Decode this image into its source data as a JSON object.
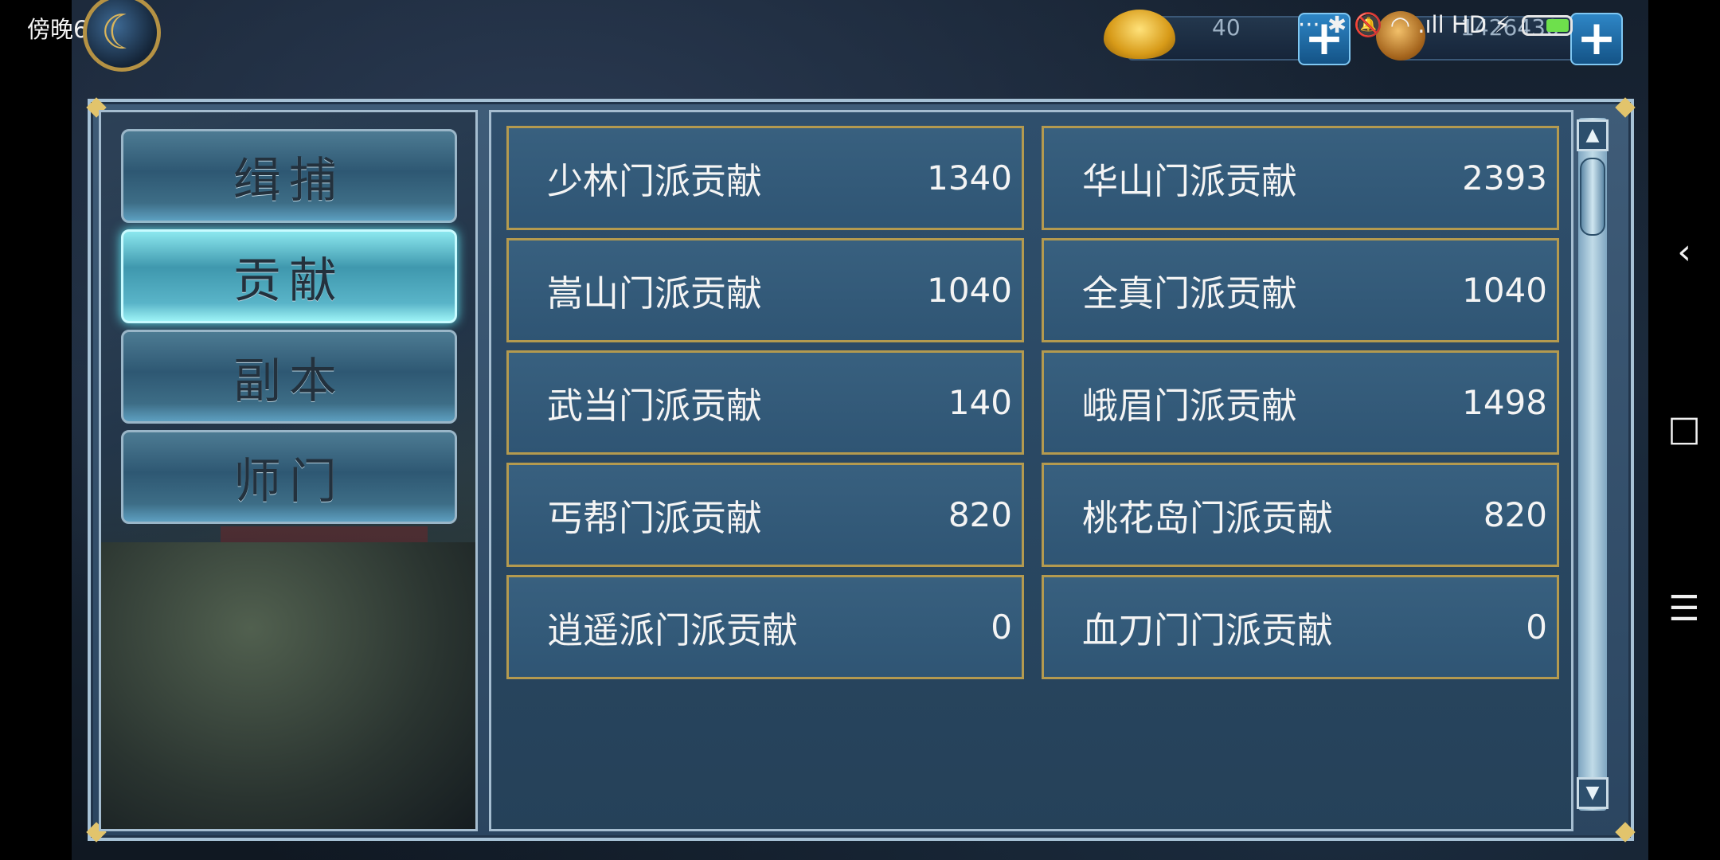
{
  "status_bar": {
    "time": "傍晚6:43",
    "icons_text": "··· ✱ 🔕 ◠ .ıll HD ⚡",
    "battery": "battery-icon"
  },
  "hud": {
    "gold_ingot_value": "40",
    "coin_value": "1426430",
    "plus_label": "+"
  },
  "tabs": [
    {
      "label": "缉捕",
      "active": false
    },
    {
      "label": "贡献",
      "active": true
    },
    {
      "label": "副本",
      "active": false
    },
    {
      "label": "师门",
      "active": false
    }
  ],
  "contributions": [
    {
      "name": "少林门派贡献",
      "value": "1340"
    },
    {
      "name": "华山门派贡献",
      "value": "2393"
    },
    {
      "name": "嵩山门派贡献",
      "value": "1040"
    },
    {
      "name": "全真门派贡献",
      "value": "1040"
    },
    {
      "name": "武当门派贡献",
      "value": "140"
    },
    {
      "name": "峨眉门派贡献",
      "value": "1498"
    },
    {
      "name": "丐帮门派贡献",
      "value": "820"
    },
    {
      "name": "桃花岛门派贡献",
      "value": "820"
    },
    {
      "name": "逍遥派门派贡献",
      "value": "0"
    },
    {
      "name": "血刀门门派贡献",
      "value": "0"
    }
  ],
  "navigation": {
    "back": "‹",
    "home": "□",
    "menu": "☰"
  },
  "colors": {
    "cell_border": "#b49a4f",
    "active_tab": "#8be7ee",
    "panel_bg": "#2f4f6c"
  }
}
